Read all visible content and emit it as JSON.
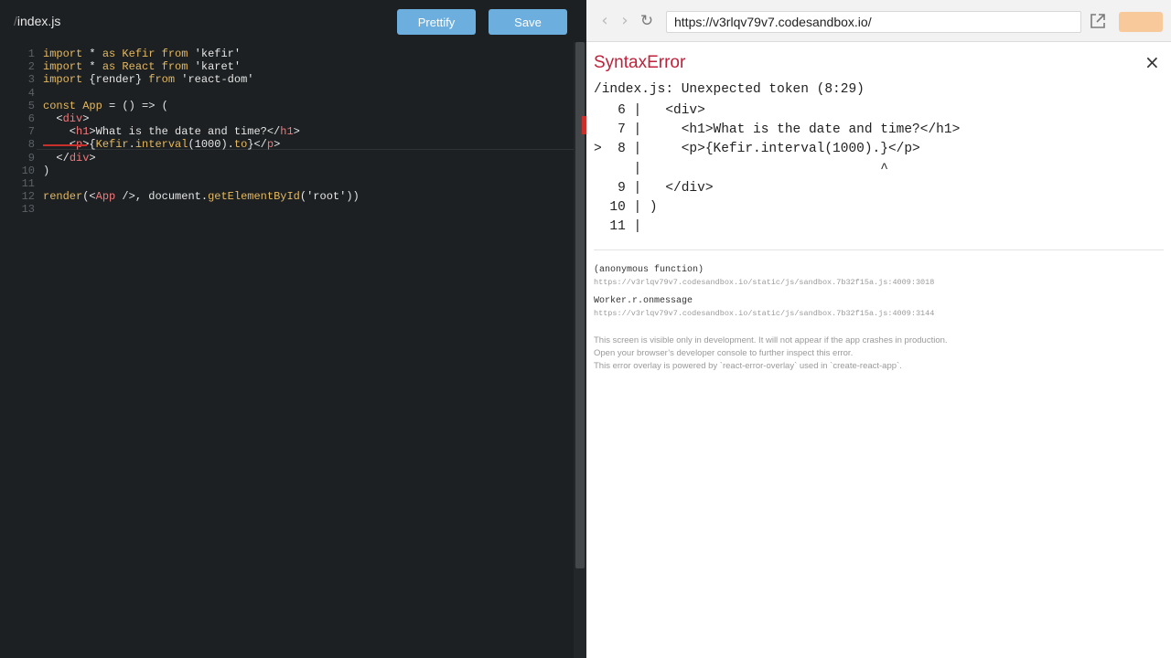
{
  "editor": {
    "file_slash": "/",
    "file_name": "index.js",
    "prettify_label": "Prettify",
    "save_label": "Save",
    "lines": [
      {
        "n": "1",
        "tokens": [
          [
            "kw",
            "import"
          ],
          [
            "pl",
            " * "
          ],
          [
            "kw",
            "as"
          ],
          [
            "fn",
            " Kefir"
          ],
          [
            "kw",
            " from"
          ],
          [
            "str",
            " 'kefir'"
          ]
        ]
      },
      {
        "n": "2",
        "tokens": [
          [
            "kw",
            "import"
          ],
          [
            "pl",
            " * "
          ],
          [
            "kw",
            "as"
          ],
          [
            "fn",
            " React"
          ],
          [
            "kw",
            " from"
          ],
          [
            "str",
            " 'karet'"
          ]
        ]
      },
      {
        "n": "3",
        "tokens": [
          [
            "kw",
            "import"
          ],
          [
            "pl",
            " {"
          ],
          [
            "var",
            "render"
          ],
          [
            "pl",
            "} "
          ],
          [
            "kw",
            "from"
          ],
          [
            "str",
            " 'react-dom'"
          ]
        ]
      },
      {
        "n": "4",
        "tokens": []
      },
      {
        "n": "5",
        "tokens": [
          [
            "kw",
            "const"
          ],
          [
            "fn",
            " App"
          ],
          [
            "pl",
            " = () => ("
          ]
        ]
      },
      {
        "n": "6",
        "tokens": [
          [
            "pl",
            "  <"
          ],
          [
            "tag",
            "div"
          ],
          [
            "pl",
            ">"
          ]
        ]
      },
      {
        "n": "7",
        "tokens": [
          [
            "pl",
            "    <"
          ],
          [
            "tag",
            "h1"
          ],
          [
            "pl",
            ">What is the date and time?</"
          ],
          [
            "tag",
            "h1"
          ],
          [
            "pl",
            ">"
          ]
        ]
      },
      {
        "n": "8",
        "tokens": [
          [
            "pl",
            "    <"
          ],
          [
            "tag",
            "p"
          ],
          [
            "pl",
            ">{"
          ],
          [
            "fn",
            "Kefir"
          ],
          [
            "pl",
            "."
          ],
          [
            "fn",
            "interval"
          ],
          [
            "pl",
            "(1000)."
          ],
          [
            "fn",
            "to"
          ],
          [
            "pl",
            "}</"
          ],
          [
            "tag",
            "p"
          ],
          [
            "pl",
            ">"
          ]
        ]
      },
      {
        "n": "9",
        "tokens": [
          [
            "pl",
            "  </"
          ],
          [
            "tag",
            "div"
          ],
          [
            "pl",
            ">"
          ]
        ]
      },
      {
        "n": "10",
        "tokens": [
          [
            "pl",
            ")"
          ]
        ]
      },
      {
        "n": "11",
        "tokens": []
      },
      {
        "n": "12",
        "tokens": [
          [
            "fn",
            "render"
          ],
          [
            "pl",
            "(<"
          ],
          [
            "tag",
            "App"
          ],
          [
            "pl",
            " />, "
          ],
          [
            "var",
            "document"
          ],
          [
            "pl",
            "."
          ],
          [
            "fn",
            "getElementById"
          ],
          [
            "pl",
            "("
          ],
          [
            "str",
            "'root'"
          ],
          [
            "pl",
            "))"
          ]
        ]
      },
      {
        "n": "13",
        "tokens": []
      }
    ]
  },
  "browser": {
    "url": "https://v3rlqv79v7.codesandbox.io/",
    "back_icon": "chevron-left-icon",
    "forward_icon": "chevron-right-icon",
    "reload_icon": "reload-icon",
    "open_icon": "open-external-icon"
  },
  "overlay": {
    "title": "SyntaxError",
    "close": "×",
    "message": "/index.js: Unexpected token (8:29)",
    "frame_lines": [
      "   6 |   <div>",
      "   7 |     <h1>What is the date and time?</h1>",
      ">  8 |     <p>{Kefir.interval(1000).}</p>",
      "     |                              ^",
      "   9 |   </div>",
      "  10 | )",
      "  11 |"
    ],
    "stack": [
      {
        "fn": "(anonymous function)",
        "url": "https://v3rlqv79v7.codesandbox.io/static/js/sandbox.7b32f15a.js:4009:3018"
      },
      {
        "fn": "Worker.r.onmessage",
        "url": "https://v3rlqv79v7.codesandbox.io/static/js/sandbox.7b32f15a.js:4009:3144"
      }
    ],
    "notes": [
      "This screen is visible only in development. It will not appear if the app crashes in production.",
      "Open your browser’s developer console to further inspect this error.",
      "This error overlay is powered by `react-error-overlay` used in `create-react-app`."
    ]
  }
}
